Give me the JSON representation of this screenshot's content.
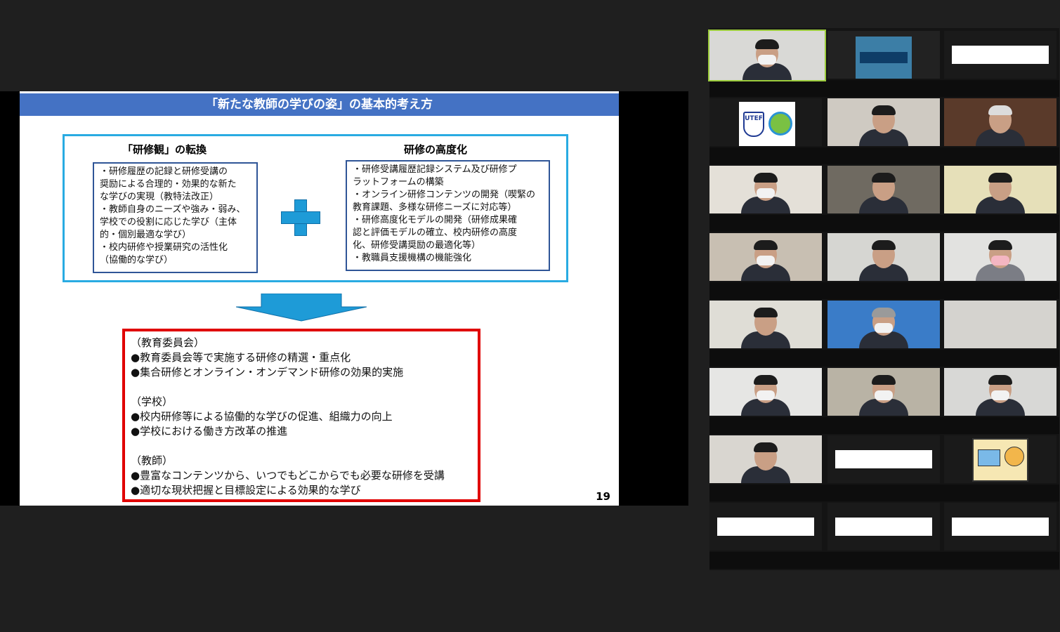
{
  "slide": {
    "title": "「新たな教師の学びの姿」の基本的考え方",
    "left_heading": "「研修観」の転換",
    "left_lines": [
      "・研修履歴の記録と研修受講の",
      "奨励による合理的・効果的な新た",
      "な学びの実現（教特法改正）",
      "・教師自身のニーズや強み・弱み、",
      "学校での役割に応じた学び（主体",
      "的・個別最適な学び）",
      "・校内研修や授業研究の活性化",
      "（協働的な学び）"
    ],
    "right_heading": "研修の高度化",
    "right_lines": [
      "・研修受講履歴記録システム及び研修プ",
      "ラットフォームの構築",
      "・オンライン研修コンテンツの開発（喫緊の",
      "教育課題、多様な研修ニーズに対応等）",
      "・研修高度化モデルの開発（研修成果確",
      "認と評価モデルの確立、校内研修の高度",
      "化、研修受講奨励の最適化等）",
      "・教職員支援機構の機能強化"
    ],
    "bottom_lines": [
      "（教育委員会）",
      "●教育委員会等で実施する研修の精選・重点化",
      "●集合研修とオンライン・オンデマンド研修の効果的実施",
      "",
      "（学校）",
      "●校内研修等による協働的な学びの促進、組織力の向上",
      "●学校における働き方改革の推進",
      "",
      "（教師）",
      "●豊富なコンテンツから、いつでもどこからでも必要な研修を受講",
      "●適切な現状把握と目標設定による効果的な学び"
    ],
    "page_number": "19"
  },
  "logo_text": "UTEF",
  "colors": {
    "title_bar": "#4472c4",
    "top_frame": "#29abe2",
    "inner_frame": "#2f5597",
    "plus": "#1e9bd7",
    "red_frame": "#e00000",
    "active_speaker": "#9ccc3c"
  }
}
